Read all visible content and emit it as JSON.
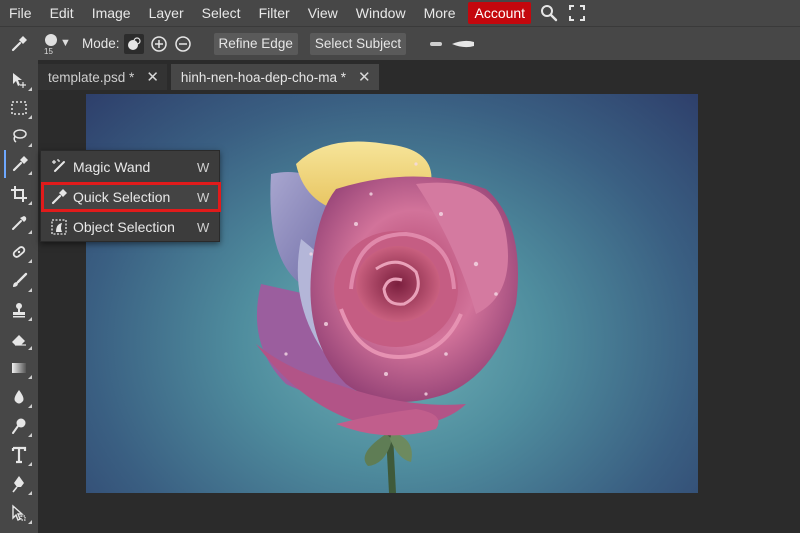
{
  "menubar": {
    "items": [
      "File",
      "Edit",
      "Image",
      "Layer",
      "Select",
      "Filter",
      "View",
      "Window",
      "More"
    ],
    "account_label": "Account",
    "icons": [
      "search-icon",
      "fullscreen-icon"
    ]
  },
  "options": {
    "brush_size": "15",
    "mode_label": "Mode:",
    "refine_edge": "Refine Edge",
    "select_subject": "Select Subject"
  },
  "tabs": [
    {
      "title": "template.psd *",
      "close": "✕"
    },
    {
      "title": "hinh-nen-hoa-dep-cho-ma *",
      "close": "✕"
    }
  ],
  "flyout": {
    "items": [
      {
        "label": "Magic Wand",
        "key": "W",
        "icon": "magic-wand-icon"
      },
      {
        "label": "Quick Selection",
        "key": "W",
        "icon": "quick-selection-icon"
      },
      {
        "label": "Object Selection",
        "key": "W",
        "icon": "object-selection-icon"
      }
    ]
  },
  "colors": {
    "accent": "#c4070d",
    "highlight_border": "#e11b1b",
    "panel": "#474747",
    "workspace": "#2b2b2b"
  }
}
